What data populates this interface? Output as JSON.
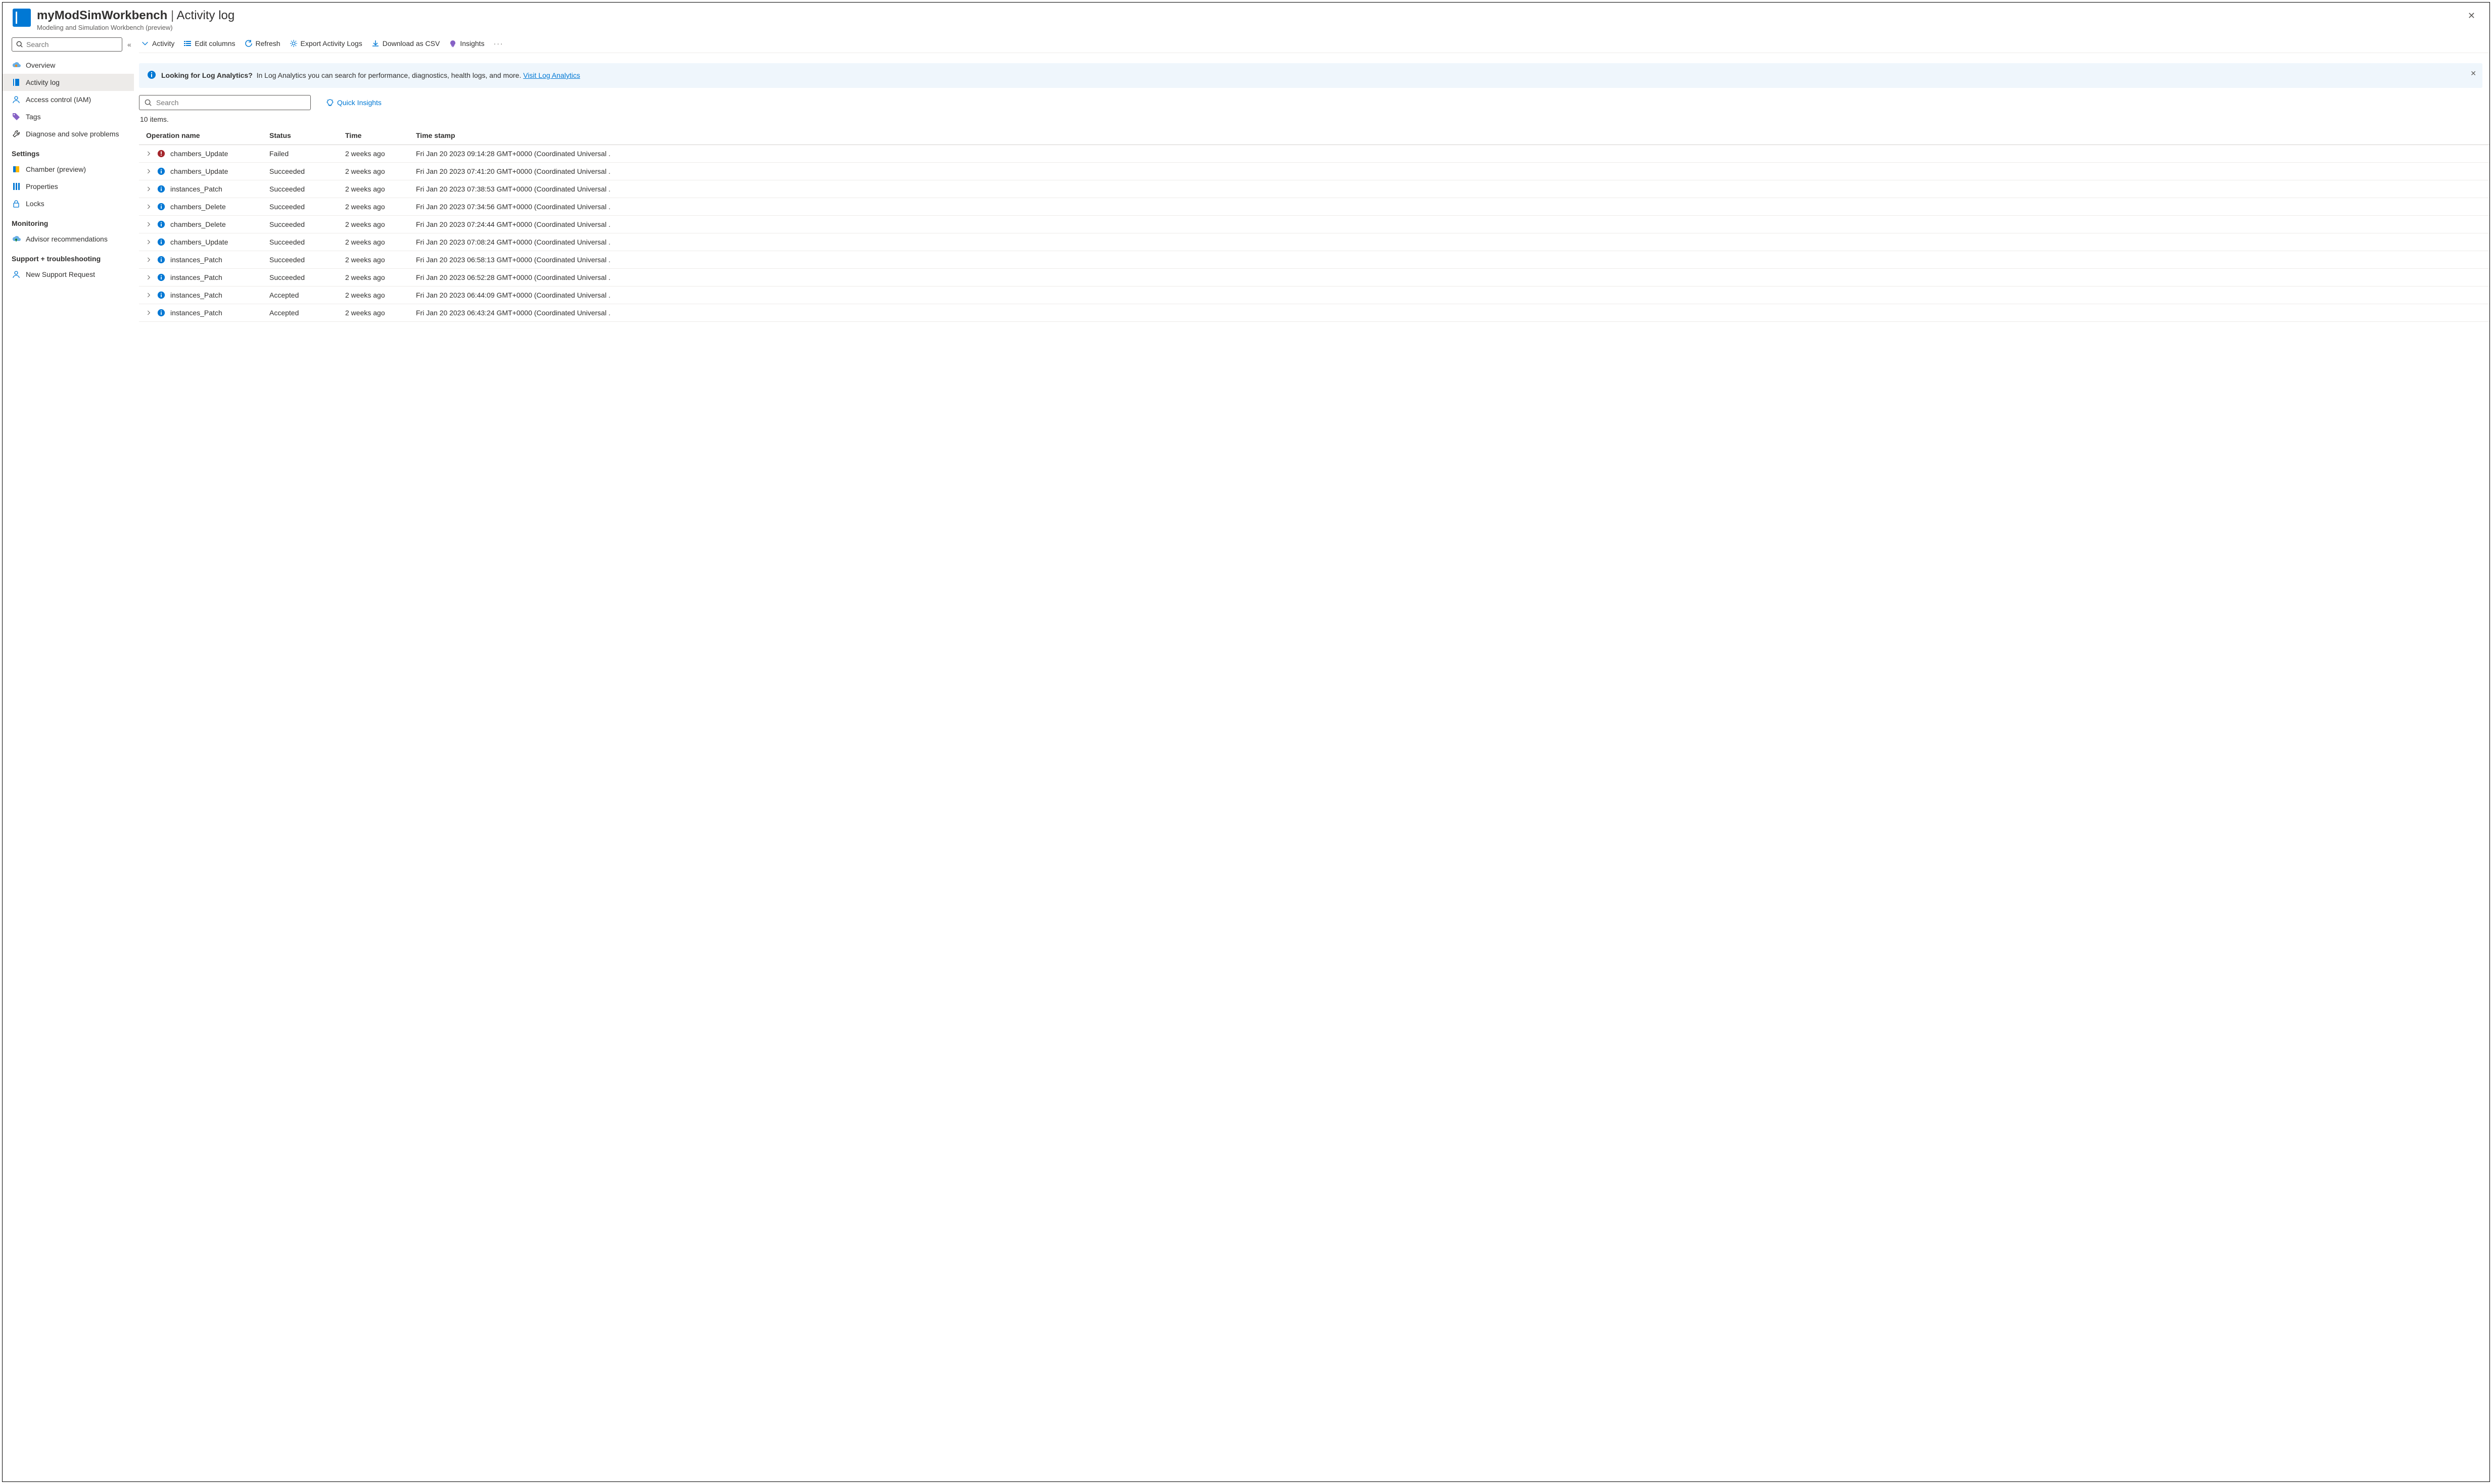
{
  "header": {
    "resource_name": "myModSimWorkbench",
    "page_name": "Activity log",
    "subtitle": "Modeling and Simulation Workbench (preview)"
  },
  "sidebar": {
    "search_placeholder": "Search",
    "groups": [
      {
        "kind": "item",
        "label": "Overview",
        "icon": "overview-icon"
      },
      {
        "kind": "item",
        "label": "Activity log",
        "icon": "activity-log-icon",
        "selected": true
      },
      {
        "kind": "item",
        "label": "Access control (IAM)",
        "icon": "access-control-icon"
      },
      {
        "kind": "item",
        "label": "Tags",
        "icon": "tags-icon"
      },
      {
        "kind": "item",
        "label": "Diagnose and solve problems",
        "icon": "diagnose-icon"
      },
      {
        "kind": "header",
        "label": "Settings"
      },
      {
        "kind": "item",
        "label": "Chamber (preview)",
        "icon": "chamber-icon"
      },
      {
        "kind": "item",
        "label": "Properties",
        "icon": "properties-icon"
      },
      {
        "kind": "item",
        "label": "Locks",
        "icon": "locks-icon"
      },
      {
        "kind": "header",
        "label": "Monitoring"
      },
      {
        "kind": "item",
        "label": "Advisor recommendations",
        "icon": "advisor-icon"
      },
      {
        "kind": "header",
        "label": "Support + troubleshooting"
      },
      {
        "kind": "item",
        "label": "New Support Request",
        "icon": "support-request-icon"
      }
    ]
  },
  "toolbar": {
    "activity": "Activity",
    "edit_columns": "Edit columns",
    "refresh": "Refresh",
    "export": "Export Activity Logs",
    "download": "Download as CSV",
    "insights": "Insights"
  },
  "banner": {
    "title": "Looking for Log Analytics?",
    "text": "In Log Analytics you can search for performance, diagnostics, health logs, and more.",
    "link": "Visit Log Analytics"
  },
  "log_search_placeholder": "Search",
  "quick_insights_label": "Quick Insights",
  "item_count_text": "10 items.",
  "columns": {
    "operation": "Operation name",
    "status": "Status",
    "time": "Time",
    "timestamp": "Time stamp"
  },
  "rows": [
    {
      "op": "chambers_Update",
      "status": "Failed",
      "time": "2 weeks ago",
      "ts": "Fri Jan 20 2023 09:14:28 GMT+0000 (Coordinated Universal ."
    },
    {
      "op": "chambers_Update",
      "status": "Succeeded",
      "time": "2 weeks ago",
      "ts": "Fri Jan 20 2023 07:41:20 GMT+0000 (Coordinated Universal ."
    },
    {
      "op": "instances_Patch",
      "status": "Succeeded",
      "time": "2 weeks ago",
      "ts": "Fri Jan 20 2023 07:38:53 GMT+0000 (Coordinated Universal ."
    },
    {
      "op": "chambers_Delete",
      "status": "Succeeded",
      "time": "2 weeks ago",
      "ts": "Fri Jan 20 2023 07:34:56 GMT+0000 (Coordinated Universal ."
    },
    {
      "op": "chambers_Delete",
      "status": "Succeeded",
      "time": "2 weeks ago",
      "ts": "Fri Jan 20 2023 07:24:44 GMT+0000 (Coordinated Universal ."
    },
    {
      "op": "chambers_Update",
      "status": "Succeeded",
      "time": "2 weeks ago",
      "ts": "Fri Jan 20 2023 07:08:24 GMT+0000 (Coordinated Universal ."
    },
    {
      "op": "instances_Patch",
      "status": "Succeeded",
      "time": "2 weeks ago",
      "ts": "Fri Jan 20 2023 06:58:13 GMT+0000 (Coordinated Universal ."
    },
    {
      "op": "instances_Patch",
      "status": "Succeeded",
      "time": "2 weeks ago",
      "ts": "Fri Jan 20 2023 06:52:28 GMT+0000 (Coordinated Universal ."
    },
    {
      "op": "instances_Patch",
      "status": "Accepted",
      "time": "2 weeks ago",
      "ts": "Fri Jan 20 2023 06:44:09 GMT+0000 (Coordinated Universal ."
    },
    {
      "op": "instances_Patch",
      "status": "Accepted",
      "time": "2 weeks ago",
      "ts": "Fri Jan 20 2023 06:43:24 GMT+0000 (Coordinated Universal ."
    }
  ]
}
